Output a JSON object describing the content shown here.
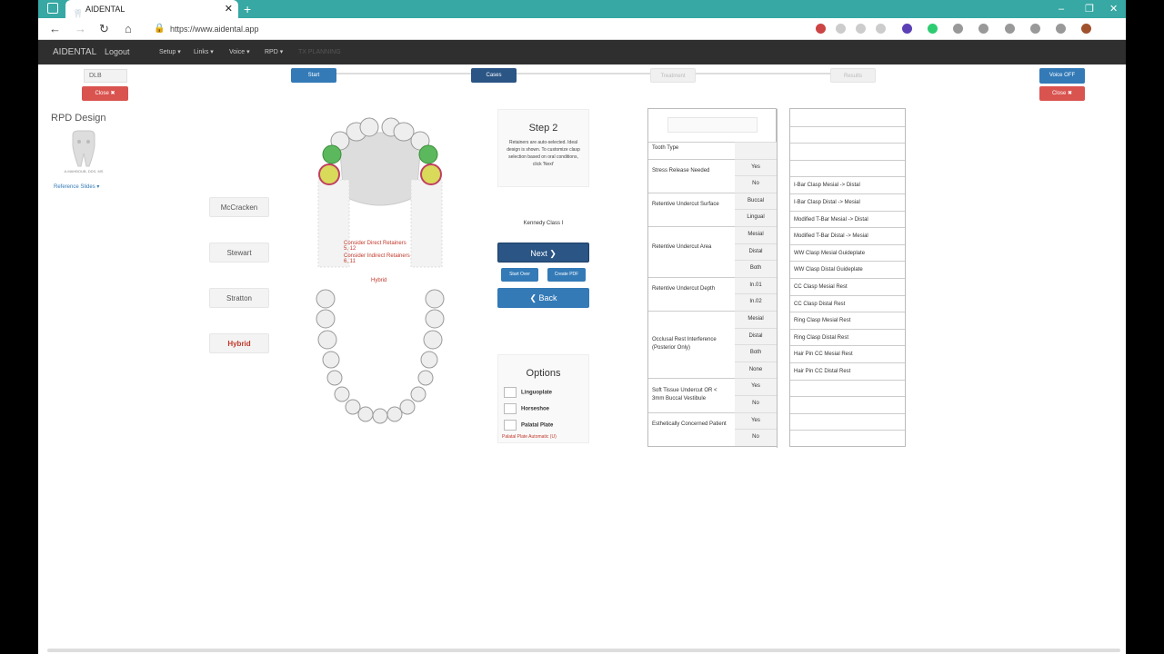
{
  "browser": {
    "tab_title": "AIDENTAL",
    "url": "https://www.aidental.app",
    "new_tab": "+",
    "tab_close": "✕",
    "win_min": "–",
    "win_max": "❐",
    "win_close": "✕"
  },
  "navbar": {
    "brand": "AIDENTAL",
    "logout": "Logout",
    "setup": "Setup ▾",
    "links": "Links ▾",
    "voice": "Voice ▾",
    "rpd": "RPD ▾",
    "planning": "TX PLANNING"
  },
  "left": {
    "input_value": "DLB",
    "close_label": "Close ✖",
    "rpd_title": "RPD Design",
    "logo_caption": "A.MAHBOUB, DDS, MS",
    "reference_slides": "Reference Slides ▾"
  },
  "right": {
    "voice_off": "Voice OFF",
    "close_label": "Close ✖"
  },
  "steps": [
    "Start",
    "Cases",
    "Treatment",
    "Results"
  ],
  "design_buttons": [
    "McCracken",
    "Stewart",
    "Stratton",
    "Hybrid"
  ],
  "chart_annotations": {
    "direct": "Consider Direct Retainers",
    "direct_teeth": "5, 12",
    "indirect": "Consider Indirect Retainers",
    "indirect_teeth": "6, 11",
    "design": "Hybrid"
  },
  "step_panel": {
    "title": "Step 2",
    "description": "Retainers are auto-selected. Ideal design is shown. To customize clasp selection based on oral conditions, click 'Next'",
    "kennedy": "Kennedy Class I",
    "next": "Next ❯",
    "start_over": "Start Over",
    "create_pdf": "Create PDF",
    "back": "❮ Back"
  },
  "options": {
    "title": "Options",
    "items": [
      "Linguoplate",
      "Horseshoe",
      "Palatal Plate"
    ],
    "auto": "Palatal Plate Automatic (U)"
  },
  "criteria": [
    {
      "label": "Tooth Type",
      "options": [
        ""
      ]
    },
    {
      "label": "Stress Release Needed",
      "options": [
        "Yes",
        "No"
      ]
    },
    {
      "label": "Retentive Undercut Surface",
      "options": [
        "Buccal",
        "Lingual"
      ]
    },
    {
      "label": "Retentive Undercut Area",
      "options": [
        "Mesial",
        "Distal",
        "Both"
      ]
    },
    {
      "label": "Retentive Undercut Depth",
      "options": [
        "In.01",
        "In.02"
      ]
    },
    {
      "label": "Occlusal Rest Interference (Posterior Only)",
      "options": [
        "Mesial",
        "Distal",
        "Both",
        "None"
      ]
    },
    {
      "label": "Soft Tissue Undercut OR < 3mm Buccal Vestibule",
      "options": [
        "Yes",
        "No"
      ]
    },
    {
      "label": "Esthetically Concerned Patient",
      "options": [
        "Yes",
        "No"
      ]
    }
  ],
  "clasps": [
    "",
    "",
    "",
    "",
    "I-Bar Clasp Mesial -> Distal",
    "I-Bar Clasp Distal -> Mesial",
    "Modified T-Bar Mesial -> Distal",
    "Modified T-Bar Distal -> Mesial",
    "WW Clasp Mesial Guideplate",
    "WW Clasp Distal Guideplate",
    "CC Clasp Mesial Rest",
    "CC Clasp Distal Rest",
    "Ring Clasp Mesial Rest",
    "Ring Clasp Distal Rest",
    "Hair Pin CC Mesial Rest",
    "Hair Pin CC Distal Rest",
    "",
    "",
    "",
    ""
  ],
  "colors": {
    "accent": "#337ab7",
    "navy": "#2a5585",
    "danger": "#d9534f",
    "tabbar": "#37a8a4"
  }
}
